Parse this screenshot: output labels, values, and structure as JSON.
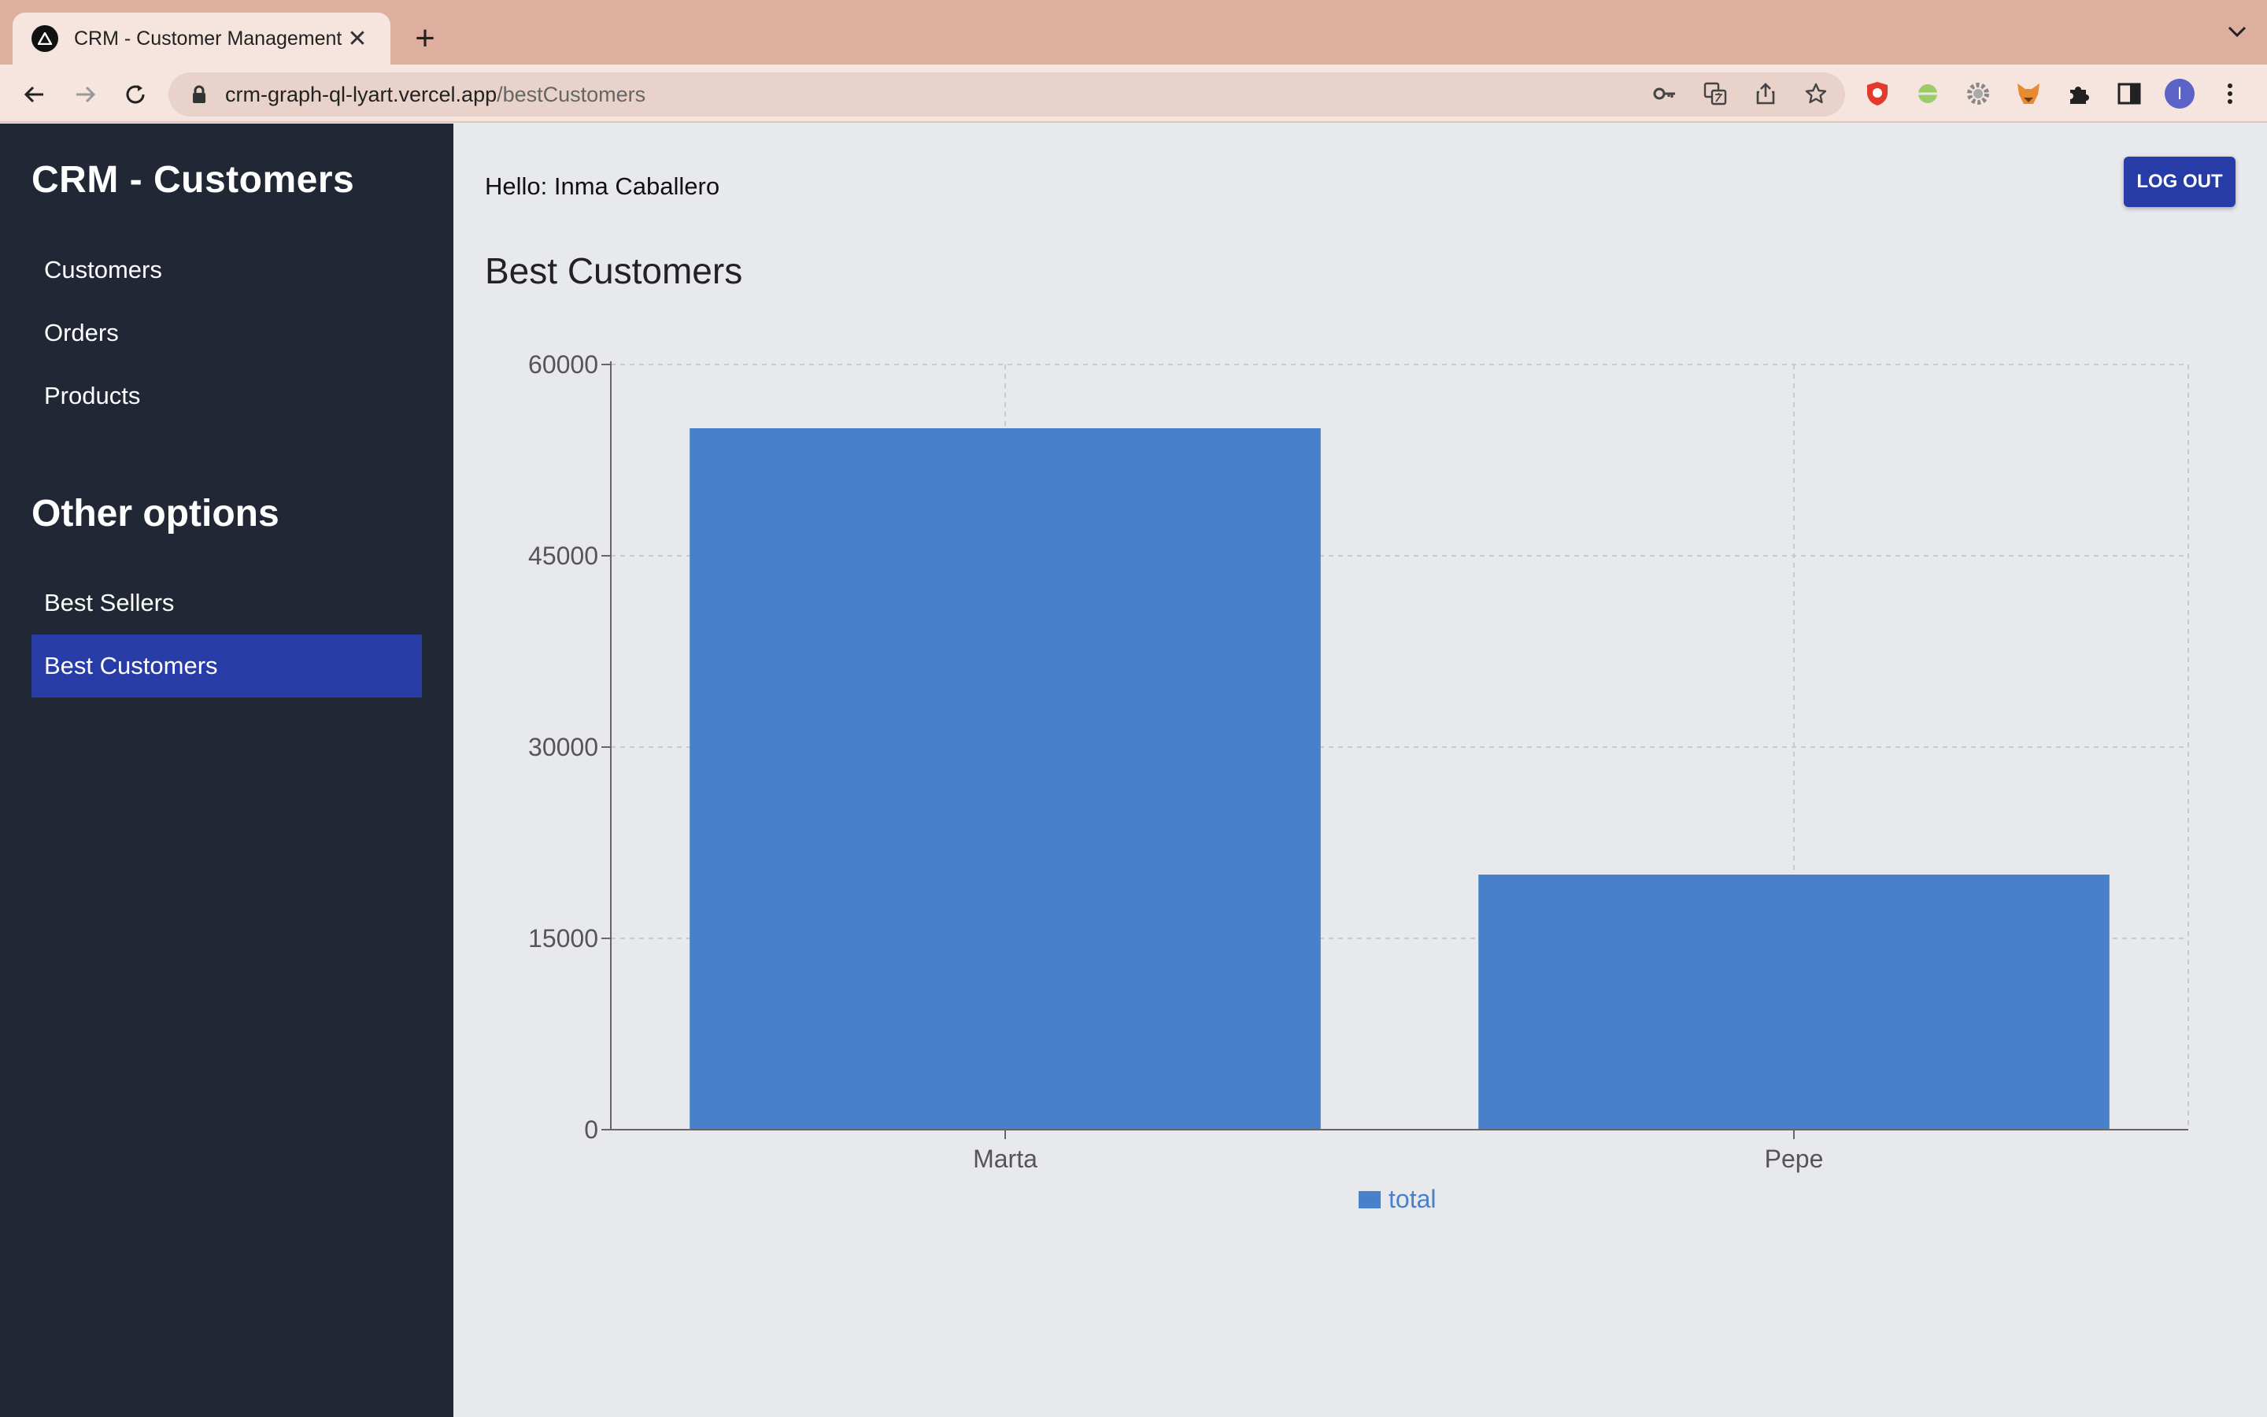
{
  "browser": {
    "tab_title": "CRM - Customer Management",
    "url_host": "crm-graph-ql-lyart.vercel.app",
    "url_path": "/bestCustomers",
    "profile_initial": "I"
  },
  "sidebar": {
    "brand": "CRM - Customers",
    "main_items": [
      {
        "label": "Customers"
      },
      {
        "label": "Orders"
      },
      {
        "label": "Products"
      }
    ],
    "other_title": "Other options",
    "other_items": [
      {
        "label": "Best Sellers",
        "active": false
      },
      {
        "label": "Best Customers",
        "active": true
      }
    ]
  },
  "header": {
    "greeting": "Hello: Inma Caballero",
    "logout_label": "LOG OUT"
  },
  "page": {
    "title": "Best Customers"
  },
  "colors": {
    "sidebar_bg": "#212735",
    "accent": "#283ca7",
    "bar": "#4881c9"
  },
  "chart_data": {
    "type": "bar",
    "categories": [
      "Marta",
      "Pepe"
    ],
    "series": [
      {
        "name": "total",
        "values": [
          55000,
          20000
        ]
      }
    ],
    "ylim": [
      0,
      60000
    ],
    "yticks": [
      0,
      15000,
      30000,
      45000,
      60000
    ],
    "grid": true,
    "legend": "bottom"
  }
}
